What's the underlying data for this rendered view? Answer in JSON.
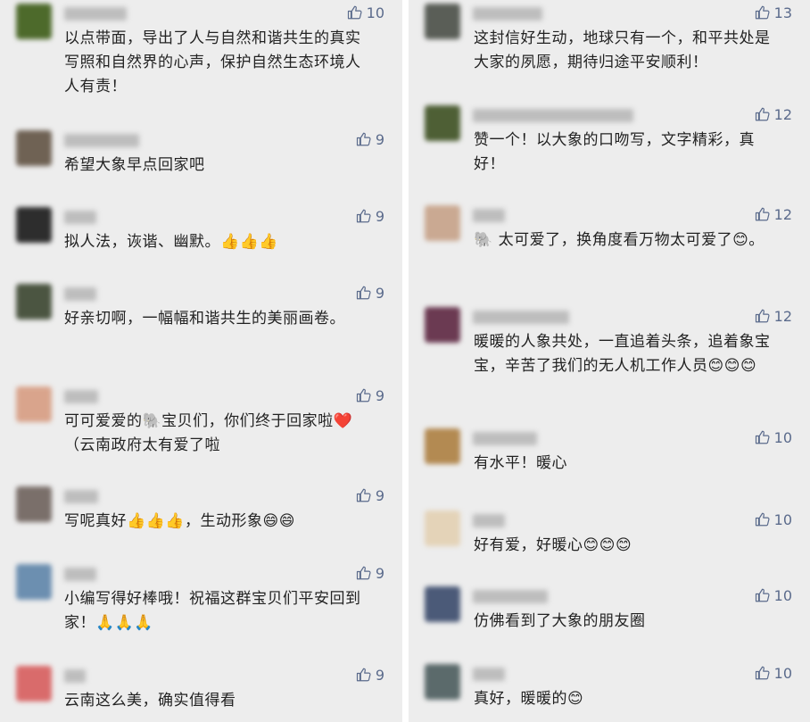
{
  "colors": {
    "background": "#ededed",
    "text": "#222222",
    "like_count": "#5b6b8c",
    "divider": "#ffffff"
  },
  "icons": {
    "like": "thumbs-up-icon"
  },
  "left_column": [
    {
      "likes": "10",
      "text": "以点带面，导出了人与自然和谐共生的真实写照和自然界的心声，保护自然生态环境人人有责！"
    },
    {
      "likes": "9",
      "text": "希望大象早点回家吧"
    },
    {
      "likes": "9",
      "text": "拟人法，诙谐、幽默。👍👍👍"
    },
    {
      "likes": "9",
      "text": "好亲切啊，一幅幅和谐共生的美丽画卷。"
    },
    {
      "likes": "9",
      "text": "可可爱爱的🐘宝贝们，你们终于回家啦❤️（云南政府太有爱了啦"
    },
    {
      "likes": "9",
      "text": "写呢真好👍👍👍，生动形象😄😄"
    },
    {
      "likes": "9",
      "text": "小编写得好棒哦！祝福这群宝贝们平安回到家！🙏🙏🙏"
    },
    {
      "likes": "9",
      "text": "云南这么美，确实值得看"
    }
  ],
  "right_column": [
    {
      "likes": "13",
      "text": "这封信好生动，地球只有一个，和平共处是大家的夙愿，期待归途平安顺利！"
    },
    {
      "likes": "12",
      "text": "赞一个！以大象的口吻写，文字精彩，真好！"
    },
    {
      "likes": "12",
      "text": "🐘 太可爱了，换角度看万物太可爱了😊。"
    },
    {
      "likes": "12",
      "text": "暖暖的人象共处，一直追着头条，追着象宝宝，辛苦了我们的无人机工作人员😊😊😊"
    },
    {
      "likes": "10",
      "text": "有水平！暖心"
    },
    {
      "likes": "10",
      "text": "好有爱，好暖心😊😊😊"
    },
    {
      "likes": "10",
      "text": "仿佛看到了大象的朋友圈"
    },
    {
      "likes": "10",
      "text": "真好，暖暖的😊"
    }
  ]
}
